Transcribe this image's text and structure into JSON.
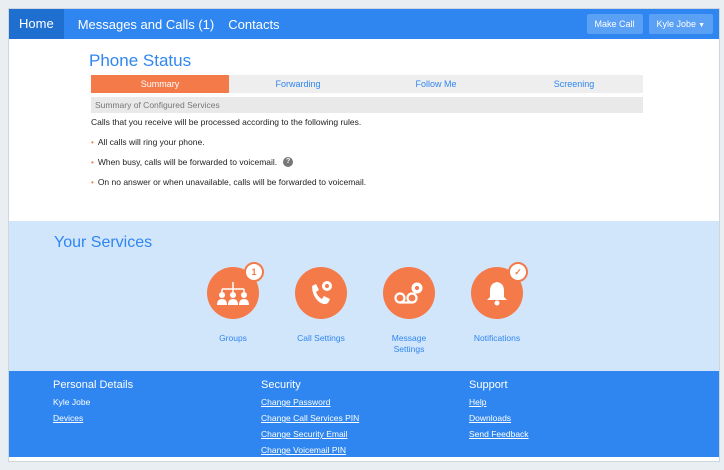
{
  "nav": {
    "home": "Home",
    "messages": "Messages and Calls (1)",
    "contacts": "Contacts",
    "make_call": "Make Call",
    "user": "Kyle Jobe"
  },
  "status": {
    "title": "Phone Status",
    "tabs": [
      "Summary",
      "Forwarding",
      "Follow Me",
      "Screening"
    ],
    "active_tab": "Summary",
    "summary_header": "Summary of Configured Services",
    "intro": "Calls that you receive will be processed according to the following rules.",
    "rules": [
      "All calls will ring your phone.",
      "When busy, calls will be forwarded to voicemail.",
      "On no answer or when unavailable, calls will be forwarded to voicemail."
    ]
  },
  "services": {
    "title": "Your Services",
    "items": [
      {
        "label": "Groups",
        "icon": "groups-icon",
        "badge": "1"
      },
      {
        "label": "Call Settings",
        "icon": "call-settings-icon"
      },
      {
        "label": "Message Settings",
        "icon": "voicemail-settings-icon"
      },
      {
        "label": "Notifications",
        "icon": "bell-icon",
        "badge": "✓"
      }
    ]
  },
  "footer": {
    "personal": {
      "title": "Personal Details",
      "name": "Kyle Jobe",
      "devices": "Devices"
    },
    "security": {
      "title": "Security",
      "links": [
        "Change Password",
        "Change Call Services PIN",
        "Change Security Email",
        "Change Voicemail PIN"
      ]
    },
    "support": {
      "title": "Support",
      "links": [
        "Help",
        "Downloads",
        "Send Feedback"
      ]
    }
  },
  "colors": {
    "accent": "#2f86f0",
    "orange": "#f47a49",
    "services_bg": "#d2e6fb"
  }
}
